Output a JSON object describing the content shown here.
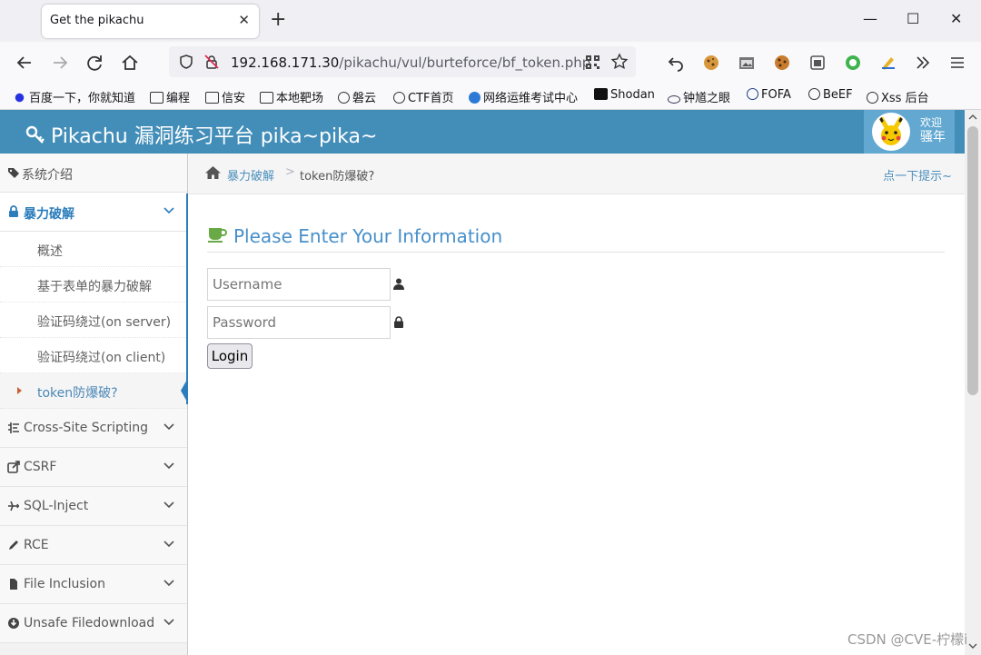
{
  "browser": {
    "tab_title": "Get the pikachu",
    "tab_close": "✕",
    "new_tab": "+",
    "window_controls": {
      "minimize": "—",
      "maximize": "☐",
      "close": "✕"
    },
    "url_host": "192.168.171.30",
    "url_path": "/pikachu/vul/burteforce/bf_token.php",
    "bookmarks": [
      "百度一下，你就知道",
      "编程",
      "信安",
      "本地靶场",
      "磐云",
      "CTF首页",
      "网络运维考试中心",
      "Shodan",
      "钟馗之眼",
      "FOFA",
      "BeEF",
      "Xss 后台"
    ]
  },
  "header": {
    "brand": "Pikachu 漏洞练习平台 pika~pika~",
    "welcome": "欢迎",
    "user": "骚年"
  },
  "sidebar": {
    "items": [
      {
        "label": "系统介绍",
        "icon": "tags-icon"
      },
      {
        "label": "暴力破解",
        "icon": "lock-icon"
      },
      {
        "label": "Cross-Site Scripting",
        "icon": "list-icon"
      },
      {
        "label": "CSRF",
        "icon": "share-icon"
      },
      {
        "label": "SQL-Inject",
        "icon": "plane-icon"
      },
      {
        "label": "RCE",
        "icon": "pencil-icon"
      },
      {
        "label": "File Inclusion",
        "icon": "file-icon"
      },
      {
        "label": "Unsafe Filedownload",
        "icon": "download-icon"
      }
    ],
    "subitems": [
      "概述",
      "基于表单的暴力破解",
      "验证码绕过(on server)",
      "验证码绕过(on client)",
      "token防爆破?"
    ]
  },
  "breadcrumb": {
    "section": "暴力破解",
    "separator": ">",
    "current": "token防爆破?",
    "hint": "点一下提示~"
  },
  "form": {
    "title": "Please Enter Your Information",
    "username_placeholder": "Username",
    "password_placeholder": "Password",
    "login_label": "Login"
  },
  "watermark": "CSDN @CVE-柠檬i",
  "colors": {
    "header": "#438eb9",
    "accent": "#2b7dbc",
    "title": "#478fca",
    "active_caret": "#c86139"
  }
}
